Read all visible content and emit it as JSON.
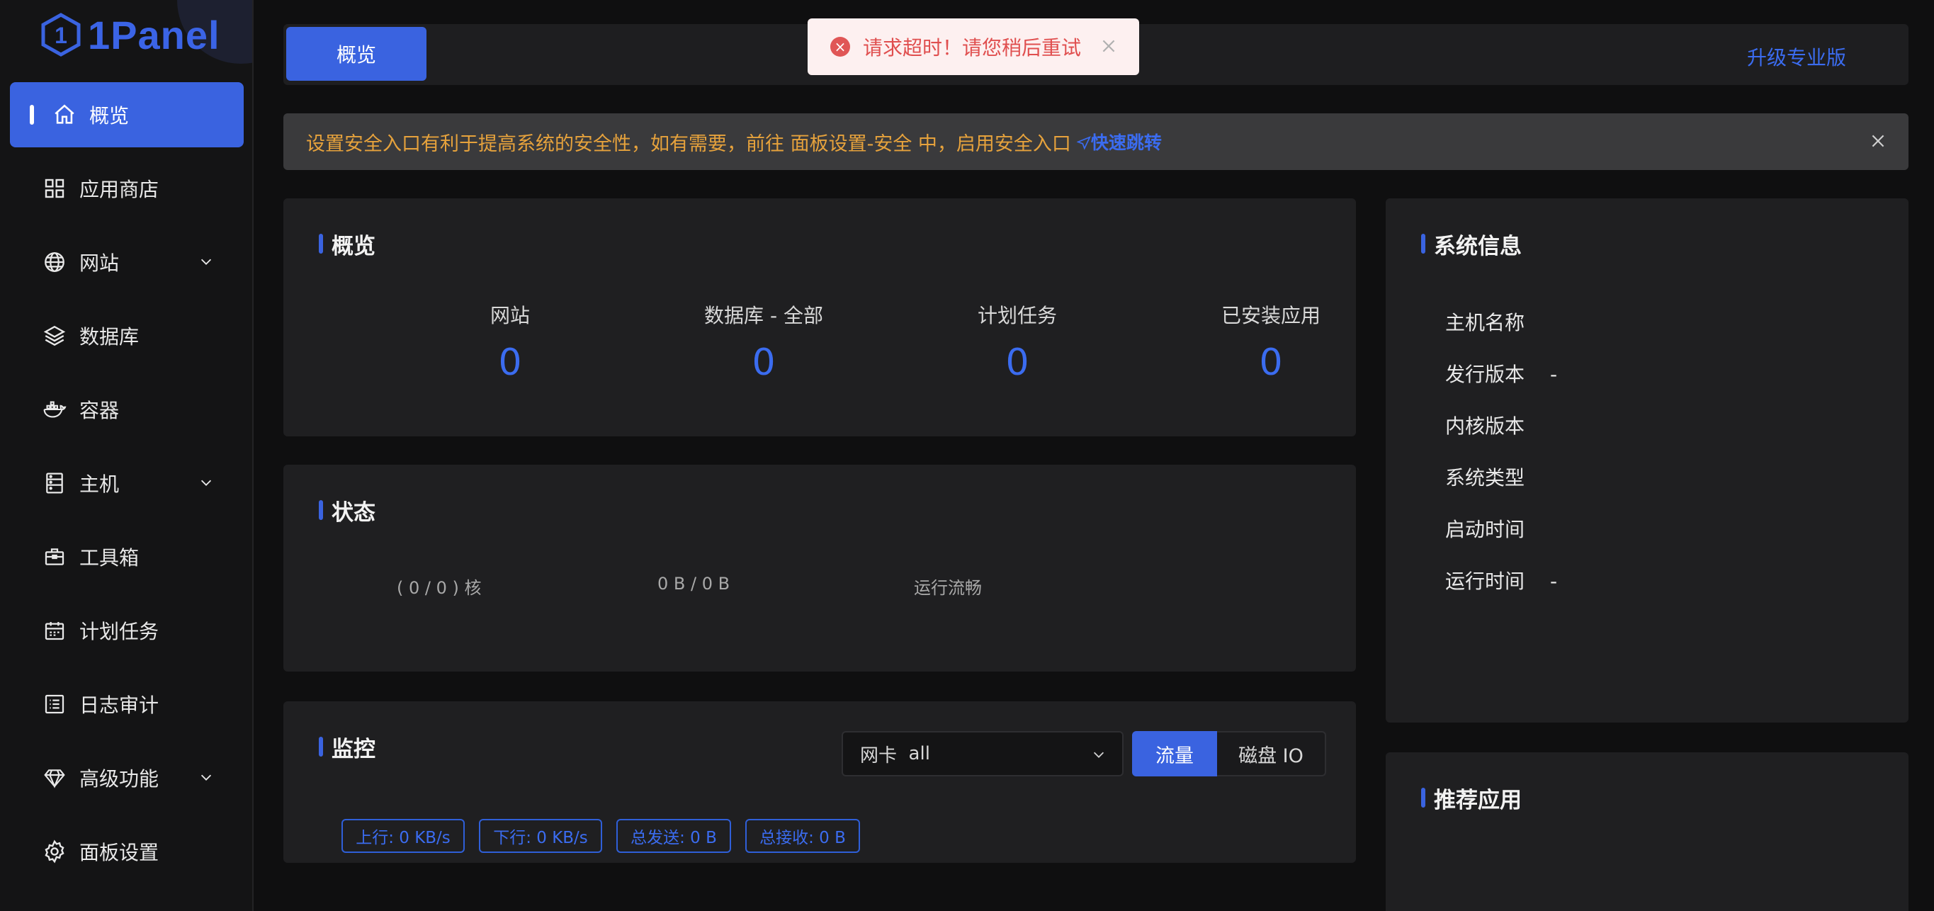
{
  "brand": {
    "name": "1Panel",
    "color": "#3a63e0"
  },
  "sidebar": {
    "items": [
      {
        "label": "概览",
        "icon": "home-icon",
        "active": true
      },
      {
        "label": "应用商店",
        "icon": "grid-icon"
      },
      {
        "label": "网站",
        "icon": "globe-icon",
        "expandable": true
      },
      {
        "label": "数据库",
        "icon": "layers-icon"
      },
      {
        "label": "容器",
        "icon": "docker-icon"
      },
      {
        "label": "主机",
        "icon": "server-icon",
        "expandable": true
      },
      {
        "label": "工具箱",
        "icon": "toolbox-icon"
      },
      {
        "label": "计划任务",
        "icon": "calendar-icon"
      },
      {
        "label": "日志审计",
        "icon": "log-icon"
      },
      {
        "label": "高级功能",
        "icon": "diamond-icon",
        "expandable": true
      },
      {
        "label": "面板设置",
        "icon": "gear-icon"
      }
    ]
  },
  "topbar": {
    "tab": "概览",
    "upgrade": "升级专业版"
  },
  "toast": {
    "message": "请求超时！请您稍后重试",
    "type": "error"
  },
  "alert": {
    "text": "设置安全入口有利于提高系统的安全性，如有需要，前往 面板设置-安全 中，启用安全入口",
    "link": "快速跳转"
  },
  "overview": {
    "title": "概览",
    "stats": [
      {
        "label": "网站",
        "value": "0"
      },
      {
        "label": "数据库 - 全部",
        "value": "0"
      },
      {
        "label": "计划任务",
        "value": "0"
      },
      {
        "label": "已安装应用",
        "value": "0"
      }
    ]
  },
  "status": {
    "title": "状态",
    "cpu": "( 0 / 0 ) 核",
    "memory": "0 B / 0 B",
    "load": "运行流畅"
  },
  "monitor": {
    "title": "监控",
    "nic_prefix": "网卡",
    "nic_value": "all",
    "tabs": {
      "flow": "流量",
      "disk": "磁盘 IO"
    },
    "tags": [
      "上行: 0 KB/s",
      "下行: 0 KB/s",
      "总发送: 0 B",
      "总接收: 0 B"
    ]
  },
  "sysinfo": {
    "title": "系统信息",
    "rows": [
      {
        "label": "主机名称",
        "value": ""
      },
      {
        "label": "发行版本",
        "value": "-"
      },
      {
        "label": "内核版本",
        "value": ""
      },
      {
        "label": "系统类型",
        "value": ""
      },
      {
        "label": "启动时间",
        "value": ""
      },
      {
        "label": "运行时间",
        "value": "-"
      }
    ]
  },
  "recommend": {
    "title": "推荐应用"
  }
}
